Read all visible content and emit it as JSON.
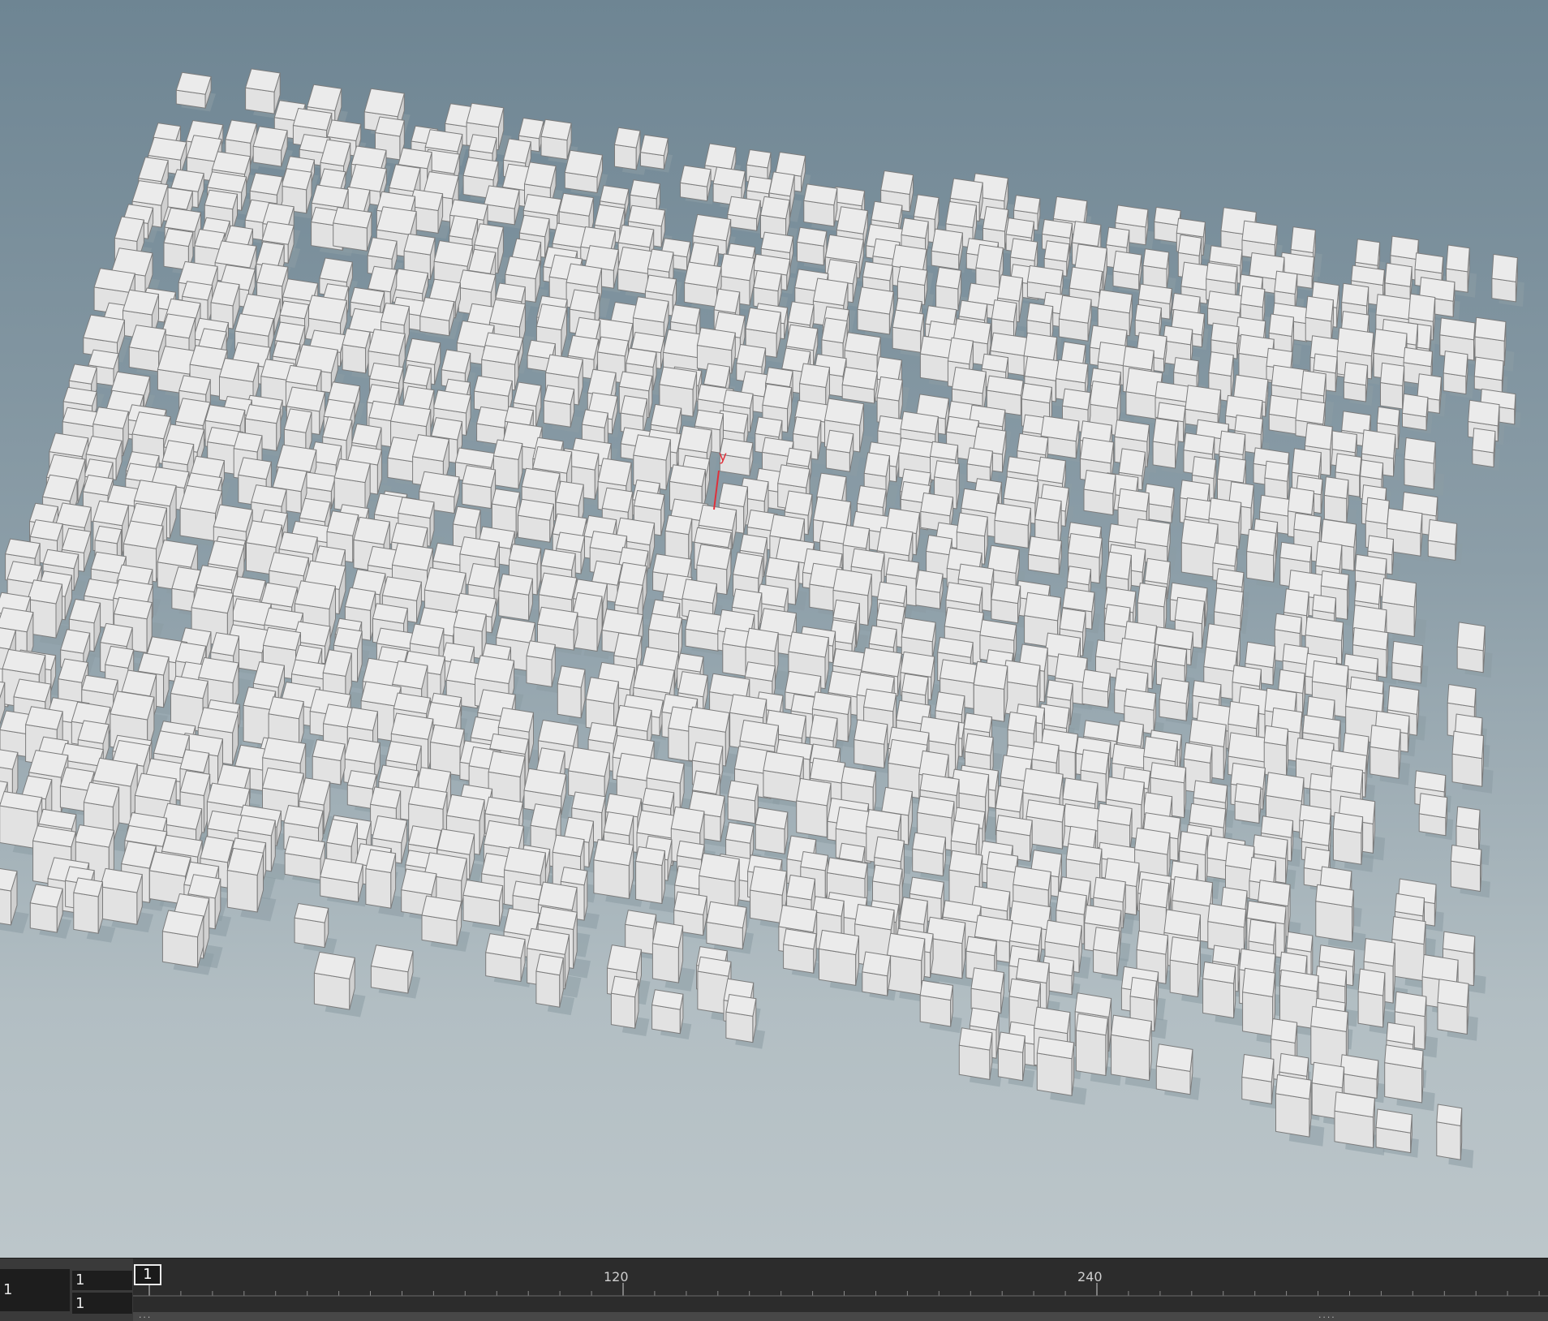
{
  "viewport": {
    "name": "3D scene viewport",
    "axis_label": "y",
    "colors": {
      "background_top": "#6e8593",
      "background_bottom": "#bcc6ca",
      "box_top": "#ebebeb",
      "box_side_light": "#e2e2e2",
      "box_side_dark": "#d0d0d0",
      "box_edge": "#7c7c7c",
      "shadow": "#8d9ca4",
      "axis": "#e0303a"
    }
  },
  "playbar": {
    "current_frame": "1",
    "start_frame": "1",
    "end_frame": "1",
    "cursor_frame": "1",
    "tick_labels": {
      "t120": "120",
      "t240": "240"
    },
    "range_handle_left": "...",
    "range_handle_right": "...."
  }
}
